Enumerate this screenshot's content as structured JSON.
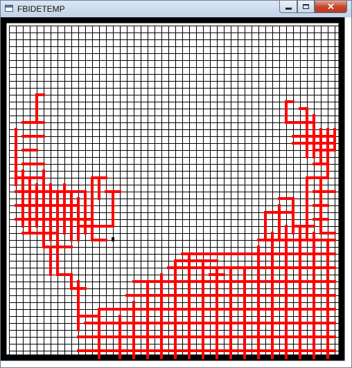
{
  "window": {
    "title": "FBIDETEMP",
    "icon": "app-window-icon",
    "controls": {
      "minimize": "minimize-icon",
      "maximize": "maximize-icon",
      "close": "close-icon"
    }
  },
  "colors": {
    "frame": "#000000",
    "grid_line": "#000000",
    "path": "#ff0000",
    "background": "#ffffff",
    "current_cell": "#000000"
  },
  "maze": {
    "columns": 48,
    "rows": 48,
    "cursor_cell": [
      15,
      31
    ],
    "path_segments": [
      [
        [
          4,
          10
        ],
        [
          5,
          10
        ]
      ],
      [
        [
          4,
          10
        ],
        [
          4,
          14
        ]
      ],
      [
        [
          2,
          14
        ],
        [
          5,
          14
        ]
      ],
      [
        [
          2,
          16
        ],
        [
          5,
          16
        ]
      ],
      [
        [
          1,
          15
        ],
        [
          1,
          23
        ]
      ],
      [
        [
          2,
          18
        ],
        [
          4,
          18
        ]
      ],
      [
        [
          2,
          20
        ],
        [
          5,
          20
        ]
      ],
      [
        [
          1,
          22
        ],
        [
          5,
          22
        ]
      ],
      [
        [
          1,
          24
        ],
        [
          11,
          24
        ]
      ],
      [
        [
          1,
          26
        ],
        [
          10,
          26
        ]
      ],
      [
        [
          2,
          21
        ],
        [
          2,
          29
        ]
      ],
      [
        [
          3,
          22
        ],
        [
          3,
          30
        ]
      ],
      [
        [
          4,
          23
        ],
        [
          4,
          29
        ]
      ],
      [
        [
          1,
          28
        ],
        [
          12,
          28
        ]
      ],
      [
        [
          2,
          30
        ],
        [
          7,
          30
        ]
      ],
      [
        [
          5,
          21
        ],
        [
          5,
          32
        ]
      ],
      [
        [
          6,
          23
        ],
        [
          6,
          31
        ]
      ],
      [
        [
          7,
          24
        ],
        [
          7,
          32
        ]
      ],
      [
        [
          5,
          32
        ],
        [
          9,
          32
        ]
      ],
      [
        [
          8,
          23
        ],
        [
          8,
          30
        ]
      ],
      [
        [
          9,
          24
        ],
        [
          9,
          31
        ]
      ],
      [
        [
          10,
          25
        ],
        [
          10,
          31
        ]
      ],
      [
        [
          11,
          24
        ],
        [
          11,
          30
        ]
      ],
      [
        [
          12,
          22
        ],
        [
          12,
          29
        ]
      ],
      [
        [
          12,
          22
        ],
        [
          14,
          22
        ]
      ],
      [
        [
          13,
          22
        ],
        [
          13,
          25
        ]
      ],
      [
        [
          14,
          24
        ],
        [
          16,
          24
        ]
      ],
      [
        [
          15,
          24
        ],
        [
          15,
          29
        ]
      ],
      [
        [
          10,
          29
        ],
        [
          15,
          29
        ]
      ],
      [
        [
          12,
          29
        ],
        [
          12,
          31
        ]
      ],
      [
        [
          12,
          31
        ],
        [
          14,
          31
        ]
      ],
      [
        [
          6,
          32
        ],
        [
          6,
          36
        ]
      ],
      [
        [
          7,
          31
        ],
        [
          7,
          36
        ]
      ],
      [
        [
          7,
          36
        ],
        [
          9,
          36
        ]
      ],
      [
        [
          9,
          36
        ],
        [
          9,
          38
        ]
      ],
      [
        [
          9,
          38
        ],
        [
          11,
          38
        ]
      ],
      [
        [
          10,
          37
        ],
        [
          10,
          40
        ]
      ],
      [
        [
          10,
          40
        ],
        [
          10,
          44
        ]
      ],
      [
        [
          10,
          42
        ],
        [
          13,
          42
        ]
      ],
      [
        [
          13,
          41
        ],
        [
          13,
          48
        ]
      ],
      [
        [
          10,
          47
        ],
        [
          47,
          47
        ]
      ],
      [
        [
          10,
          45
        ],
        [
          47,
          45
        ]
      ],
      [
        [
          11,
          43
        ],
        [
          47,
          43
        ]
      ],
      [
        [
          13,
          41
        ],
        [
          47,
          41
        ]
      ],
      [
        [
          17,
          39
        ],
        [
          47,
          39
        ]
      ],
      [
        [
          18,
          37
        ],
        [
          47,
          37
        ]
      ],
      [
        [
          23,
          35
        ],
        [
          47,
          35
        ]
      ],
      [
        [
          25,
          33
        ],
        [
          47,
          33
        ]
      ],
      [
        [
          36,
          31
        ],
        [
          47,
          31
        ]
      ],
      [
        [
          24,
          34
        ],
        [
          30,
          34
        ]
      ],
      [
        [
          26,
          33
        ],
        [
          29,
          33
        ]
      ],
      [
        [
          28,
          35
        ],
        [
          30,
          35
        ]
      ],
      [
        [
          29,
          36
        ],
        [
          31,
          36
        ]
      ],
      [
        [
          16,
          42
        ],
        [
          16,
          48
        ]
      ],
      [
        [
          18,
          40
        ],
        [
          18,
          48
        ]
      ],
      [
        [
          20,
          37
        ],
        [
          20,
          48
        ]
      ],
      [
        [
          22,
          36
        ],
        [
          22,
          48
        ]
      ],
      [
        [
          24,
          34
        ],
        [
          24,
          48
        ]
      ],
      [
        [
          26,
          33
        ],
        [
          26,
          48
        ]
      ],
      [
        [
          28,
          34
        ],
        [
          28,
          48
        ]
      ],
      [
        [
          30,
          35
        ],
        [
          30,
          48
        ]
      ],
      [
        [
          32,
          35
        ],
        [
          32,
          48
        ]
      ],
      [
        [
          34,
          35
        ],
        [
          34,
          48
        ]
      ],
      [
        [
          36,
          32
        ],
        [
          36,
          48
        ]
      ],
      [
        [
          38,
          30
        ],
        [
          38,
          48
        ]
      ],
      [
        [
          40,
          29
        ],
        [
          40,
          48
        ]
      ],
      [
        [
          42,
          29
        ],
        [
          42,
          48
        ]
      ],
      [
        [
          44,
          30
        ],
        [
          44,
          48
        ]
      ],
      [
        [
          46,
          31
        ],
        [
          46,
          48
        ]
      ],
      [
        [
          37,
          27
        ],
        [
          37,
          31
        ]
      ],
      [
        [
          37,
          27
        ],
        [
          41,
          27
        ]
      ],
      [
        [
          39,
          26
        ],
        [
          39,
          31
        ]
      ],
      [
        [
          39,
          25
        ],
        [
          41,
          25
        ]
      ],
      [
        [
          41,
          25
        ],
        [
          41,
          30
        ]
      ],
      [
        [
          41,
          29
        ],
        [
          44,
          29
        ]
      ],
      [
        [
          43,
          22
        ],
        [
          43,
          31
        ]
      ],
      [
        [
          43,
          22
        ],
        [
          46,
          22
        ]
      ],
      [
        [
          45,
          22
        ],
        [
          45,
          30
        ]
      ],
      [
        [
          44,
          24
        ],
        [
          47,
          24
        ]
      ],
      [
        [
          44,
          26
        ],
        [
          46,
          26
        ]
      ],
      [
        [
          44,
          28
        ],
        [
          46,
          28
        ]
      ],
      [
        [
          45,
          30
        ],
        [
          47,
          30
        ]
      ],
      [
        [
          43,
          31
        ],
        [
          47,
          31
        ]
      ],
      [
        [
          40,
          11
        ],
        [
          41,
          11
        ]
      ],
      [
        [
          40,
          11
        ],
        [
          40,
          14
        ]
      ],
      [
        [
          40,
          14
        ],
        [
          44,
          14
        ]
      ],
      [
        [
          42,
          12
        ],
        [
          43,
          12
        ]
      ],
      [
        [
          43,
          12
        ],
        [
          43,
          19
        ]
      ],
      [
        [
          44,
          13
        ],
        [
          44,
          19
        ]
      ],
      [
        [
          41,
          16
        ],
        [
          47,
          16
        ]
      ],
      [
        [
          41,
          17
        ],
        [
          47,
          17
        ]
      ],
      [
        [
          45,
          15
        ],
        [
          45,
          20
        ]
      ],
      [
        [
          46,
          15
        ],
        [
          46,
          22
        ]
      ],
      [
        [
          44,
          18
        ],
        [
          47,
          18
        ]
      ],
      [
        [
          44,
          20
        ],
        [
          46,
          20
        ]
      ],
      [
        [
          47,
          15
        ],
        [
          47,
          18
        ]
      ]
    ]
  }
}
